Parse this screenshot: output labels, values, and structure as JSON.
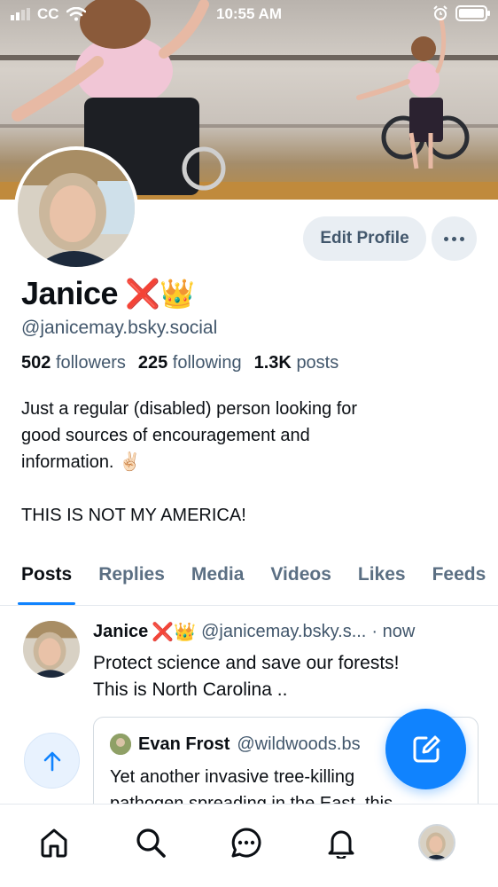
{
  "status_bar": {
    "carrier": "CC",
    "time": "10:55 AM"
  },
  "profile": {
    "display_name": "Janice",
    "name_emoji": "❌👑",
    "handle": "@janicemay.bsky.social",
    "edit_label": "Edit Profile",
    "stats": [
      {
        "num": "502",
        "label": "followers"
      },
      {
        "num": "225",
        "label": "following"
      },
      {
        "num": "1.3K",
        "label": "posts"
      }
    ],
    "bio": [
      "Just a regular (disabled) person looking for",
      "good sources of encouragement and",
      "information. ✌🏻",
      "",
      "THIS IS NOT MY AMERICA!"
    ]
  },
  "tabs": [
    "Posts",
    "Replies",
    "Media",
    "Videos",
    "Likes",
    "Feeds"
  ],
  "active_tab": "Posts",
  "post": {
    "author": "Janice",
    "author_emoji": "❌👑",
    "handle": "@janicemay.bsky.s...",
    "time": "· now",
    "text_lines": [
      "Protect science and save our forests!",
      "This is North Carolina .."
    ],
    "quote": {
      "author": "Evan Frost",
      "handle": "@wildwoods.bs",
      "text_lines": [
        "Yet another invasive tree-killing",
        "pathogen spreading in the East, this"
      ]
    }
  },
  "icons": {
    "home": "home-icon",
    "search": "search-icon",
    "chat": "chat-icon",
    "notifications": "bell-icon",
    "compose": "compose-icon",
    "scroll_top": "arrow-up-icon"
  },
  "colors": {
    "accent": "#1083fe",
    "muted_text": "#42576c",
    "button_bg": "#e9eef3"
  }
}
